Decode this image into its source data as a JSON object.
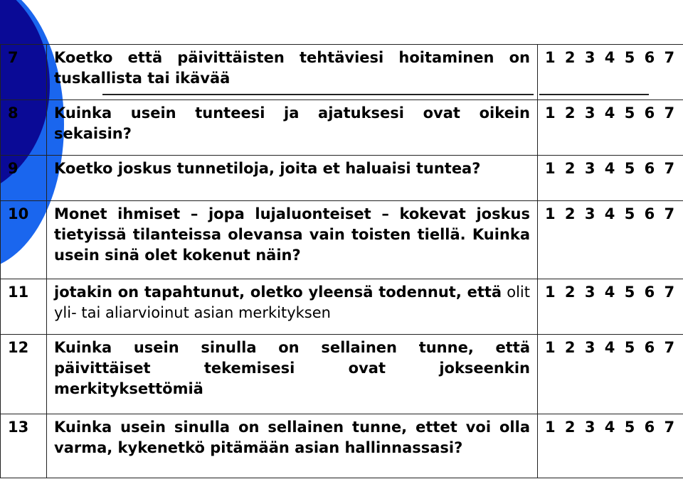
{
  "decoration": {
    "dark_circle_color": "#0a0a96",
    "light_circle_color": "#1a66ee"
  },
  "scale_label": "1 2 3 4 5 6 7",
  "rows": [
    {
      "num": "7",
      "text": "Koetko että päivittäisten tehtäviesi hoitaminen on tuskallista tai ikävää",
      "scale": "1 2 3 4 5 6 7"
    },
    {
      "num": "8",
      "text": "Kuinka usein tunteesi ja ajatuksesi ovat oikein sekaisin?",
      "scale": "1 2 3 4 5 6 7"
    },
    {
      "num": "9",
      "text": "Koetko joskus tunnetiloja, joita et haluaisi tuntea?",
      "scale": "1 2 3 4 5 6 7"
    },
    {
      "num": "10",
      "text": "Monet ihmiset – jopa lujaluonteiset – kokevat joskus tietyissä tilanteissa olevansa vain toisten tiellä. Kuinka usein sinä olet kokenut näin?",
      "scale": "1 2 3 4 5 6 7"
    },
    {
      "num": "11",
      "text_bold": "jotakin on tapahtunut, oletko yleensä todennut, että",
      "text_light": " olit yli- tai aliarvioinut asian merkityksen",
      "scale": "1 2 3 4 5 6 7"
    },
    {
      "num": "12",
      "text": "Kuinka usein sinulla on sellainen tunne, että päivittäiset tekemisesi ovat jokseenkin merkityksettömiä",
      "scale": "1 2 3 4 5 6 7"
    },
    {
      "num": "13",
      "text": "Kuinka usein sinulla on sellainen tunne, ettet voi olla varma, kykenetkö pitämään asian hallinnassasi?",
      "scale": "1 2 3 4 5 6 7"
    }
  ]
}
